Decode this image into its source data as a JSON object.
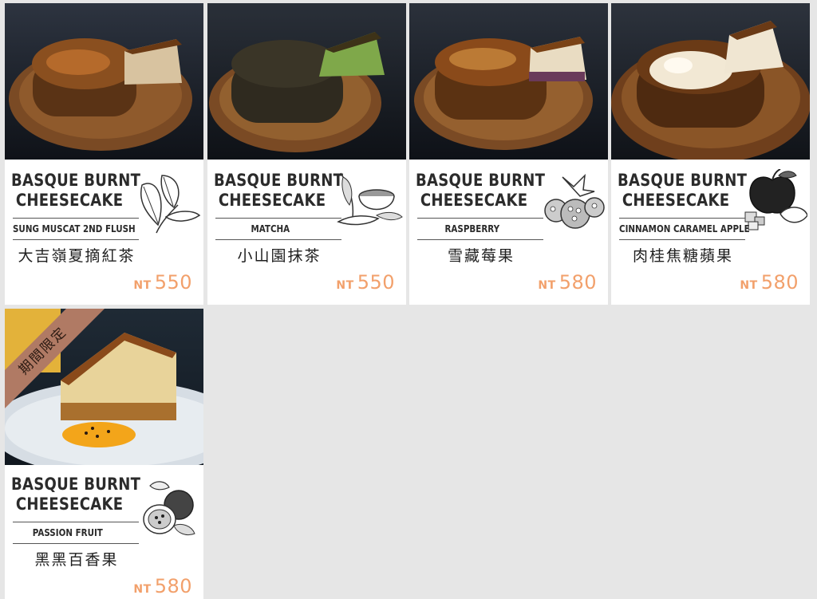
{
  "products": [
    {
      "title_line1": "BASQUE BURNT",
      "title_line2": "CHEESECAKE",
      "flavor_en": "SUNG MUSCAT 2ND FLUSH",
      "flavor_zh": "大吉嶺夏摘紅茶",
      "currency": "NT",
      "price": "550",
      "illustration": "tea-leaf-icon",
      "slice_color": "#d8c3a0"
    },
    {
      "title_line1": "BASQUE BURNT",
      "title_line2": "CHEESECAKE",
      "flavor_en": "MATCHA",
      "flavor_zh": "小山園抹茶",
      "currency": "NT",
      "price": "550",
      "illustration": "matcha-bowl-icon",
      "slice_color": "#7fa84a"
    },
    {
      "title_line1": "BASQUE BURNT",
      "title_line2": "CHEESECAKE",
      "flavor_en": "RASPBERRY",
      "flavor_zh": "雪藏莓果",
      "currency": "NT",
      "price": "580",
      "illustration": "raspberry-icon",
      "slice_color": "#e9dcc2"
    },
    {
      "title_line1": "BASQUE BURNT",
      "title_line2": "CHEESECAKE",
      "flavor_en": "CINNAMON CARAMEL APPLE",
      "flavor_zh": "肉桂焦糖蘋果",
      "currency": "NT",
      "price": "580",
      "illustration": "apple-icon",
      "slice_color": "#f0e6d2"
    },
    {
      "title_line1": "BASQUE BURNT",
      "title_line2": "CHEESECAKE",
      "flavor_en": "PASSION FRUIT",
      "flavor_zh": "黑黑百香果",
      "currency": "NT",
      "price": "580",
      "illustration": "passion-fruit-icon",
      "badge": "期間限定",
      "slice_color": "#e8d39a"
    }
  ],
  "colors": {
    "price": "#f2a06b",
    "background": "#e6e6e6",
    "badge": "#b07a64"
  }
}
